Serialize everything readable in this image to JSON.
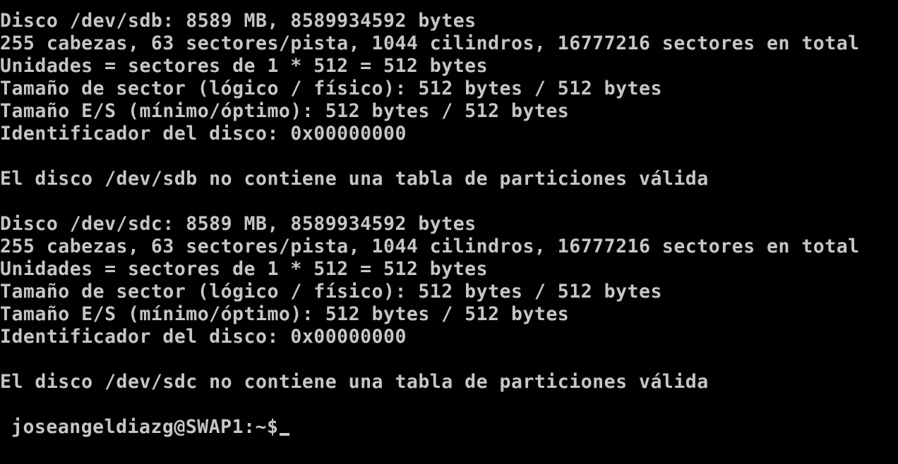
{
  "terminal": {
    "lines": [
      "Disco /dev/sdb: 8589 MB, 8589934592 bytes",
      "255 cabezas, 63 sectores/pista, 1044 cilindros, 16777216 sectores en total",
      "Unidades = sectores de 1 * 512 = 512 bytes",
      "Tamaño de sector (lógico / físico): 512 bytes / 512 bytes",
      "Tamaño E/S (mínimo/óptimo): 512 bytes / 512 bytes",
      "Identificador del disco: 0x00000000",
      "",
      "El disco /dev/sdb no contiene una tabla de particiones válida",
      "",
      "Disco /dev/sdc: 8589 MB, 8589934592 bytes",
      "255 cabezas, 63 sectores/pista, 1044 cilindros, 16777216 sectores en total",
      "Unidades = sectores de 1 * 512 = 512 bytes",
      "Tamaño de sector (lógico / físico): 512 bytes / 512 bytes",
      "Tamaño E/S (mínimo/óptimo): 512 bytes / 512 bytes",
      "Identificador del disco: 0x00000000",
      "",
      "El disco /dev/sdc no contiene una tabla de particiones válida"
    ],
    "prompt": "joseangeldiazg@SWAP1:~$",
    "colors": {
      "background": "#000000",
      "foreground": "#c6c6c6"
    }
  }
}
